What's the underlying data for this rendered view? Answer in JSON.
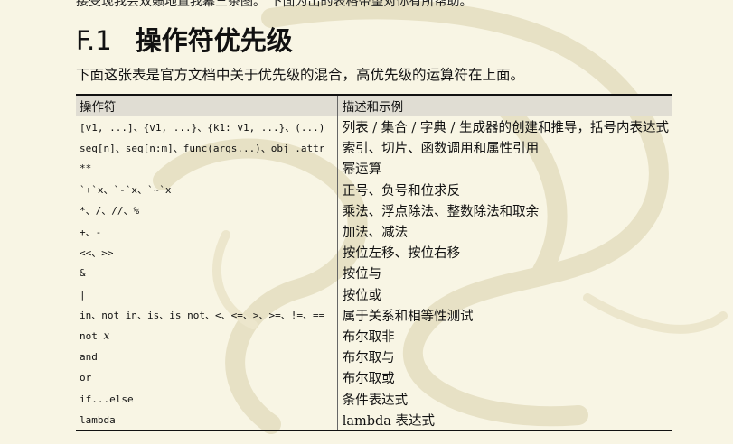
{
  "page": {
    "top_text": "接受现我会双籁地直我幕三茶图。 下面为出的表格带望对你有所帮助。",
    "section_number": "F.1",
    "section_title": "操作符优先级",
    "intro": "下面这张表是官方文档中关于优先级的混合，高优先级的运算符在上面。"
  },
  "table": {
    "headers": [
      "操作符",
      "描述和示例"
    ],
    "rows": [
      {
        "op": "[v1, ...]、{v1, ...}、{k1: v1, ...}、(...)",
        "desc": "列表 / 集合 / 字典 / 生成器的创建和推导，括号内表达式"
      },
      {
        "op": "seq[n]、seq[n:m]、func(args...)、obj .attr",
        "desc": "索引、切片、函数调用和属性引用"
      },
      {
        "op": "**",
        "desc": "幂运算"
      },
      {
        "op": "`+`x、`-`x、`~`x",
        "desc": "正号、负号和位求反"
      },
      {
        "op": "*、/、//、%",
        "desc": "乘法、浮点除法、整数除法和取余"
      },
      {
        "op": "+、-",
        "desc": "加法、减法"
      },
      {
        "op": "<<、>>",
        "desc": "按位左移、按位右移"
      },
      {
        "op": "&",
        "desc": "按位与"
      },
      {
        "op": "|",
        "desc": "按位或"
      },
      {
        "op": "in、not in、is、is not、<、<=、>、>=、!=、==",
        "desc": "属于关系和相等性测试"
      },
      {
        "op_prefix": "not ",
        "op_var": "x",
        "desc": "布尔取非"
      },
      {
        "op": "and",
        "desc": "布尔取与"
      },
      {
        "op": "or",
        "desc": "布尔取或"
      },
      {
        "op": "if...else",
        "desc": "条件表达式"
      },
      {
        "op": "lambda",
        "desc": "lambda 表达式"
      }
    ]
  }
}
